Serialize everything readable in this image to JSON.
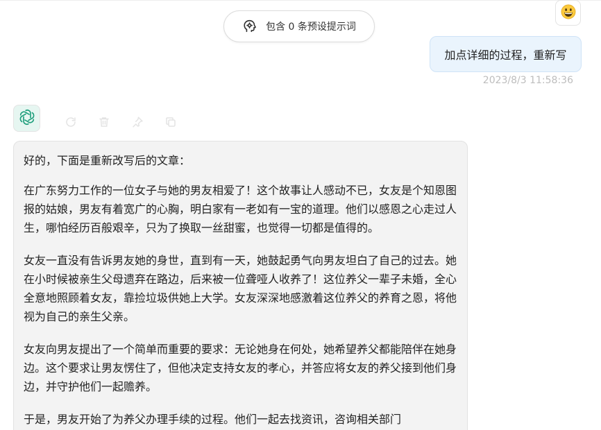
{
  "preset_button": {
    "label": "包含 0 条预设提示词",
    "icon": "brain-head-icon"
  },
  "user_message": {
    "avatar_emoji": "😃",
    "text": "加点详细的过程，重新写",
    "timestamp": "2023/8/3 11:58:36"
  },
  "bot_message": {
    "avatar_icon": "openai-logo-icon",
    "actions": [
      "refresh-icon",
      "delete-icon",
      "pin-icon",
      "copy-icon"
    ],
    "paragraphs": [
      "好的，下面是重新改写后的文章：",
      "在广东努力工作的一位女子与她的男友相爱了！这个故事让人感动不已，女友是个知恩图报的姑娘，男友有着宽广的心胸，明白家有一老如有一宝的道理。他们以感恩之心走过人生，哪怕经历百般艰辛，只为了换取一丝甜蜜，也觉得一切都是值得的。",
      "女友一直没有告诉男友她的身世，直到有一天，她鼓起勇气向男友坦白了自己的过去。她在小时候被亲生父母遗弃在路边，后来被一位聋哑人收养了！这位养父一辈子未婚，全心全意地照顾着女友，靠捡垃圾供她上大学。女友深深地感激着这位养父的养育之恩，将他视为自己的亲生父亲。",
      "女友向男友提出了一个简单而重要的要求：无论她身在何处，她希望养父都能陪伴在她身边。这个要求让男友愣住了，但他决定支持女友的孝心，并答应将女友的养父接到他们身边，并守护他们一起赡养。",
      "于是，男友开始了为养父办理手续的过程。他们一起去找资讯，咨询相关部门"
    ]
  },
  "colors": {
    "user_bubble_bg": "#eaf4fd",
    "bot_bubble_bg": "#f3f3f3",
    "bot_avatar_bg": "#e6f6f1",
    "timestamp": "#bdbdbd"
  }
}
